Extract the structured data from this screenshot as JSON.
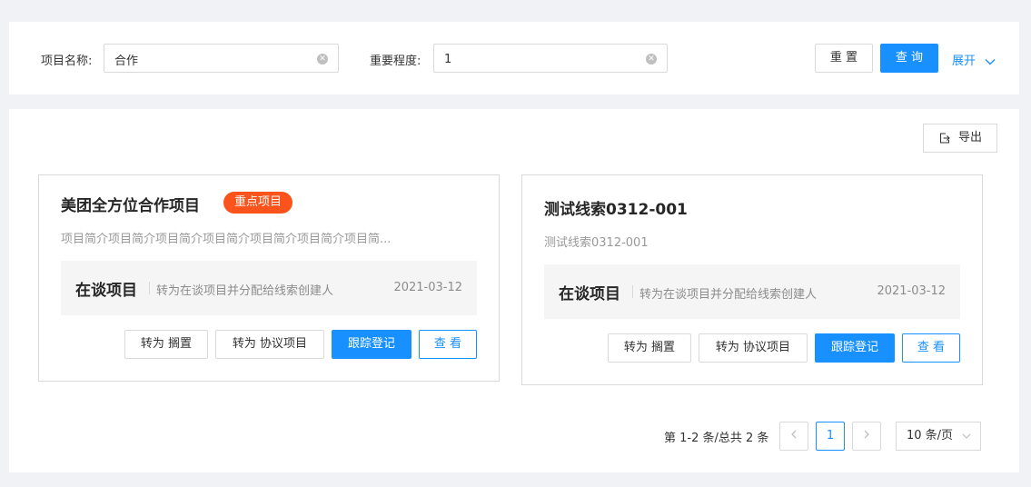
{
  "filters": {
    "project_name_label": "项目名称:",
    "project_name_value": "合作",
    "importance_label": "重要程度:",
    "importance_value": "1",
    "reset_label": "重 置",
    "search_label": "查 询",
    "expand_label": "展开"
  },
  "toolbar": {
    "export_label": "导出"
  },
  "cards": [
    {
      "title": "美团全方位合作项目",
      "tag": "重点项目",
      "description": "项目简介项目简介项目简介项目简介项目简介项目简介项目简...",
      "status": "在谈项目",
      "status_note": "转为在谈项目并分配给线索创建人",
      "date": "2021-03-12",
      "actions": [
        "转为 搁置",
        "转为 协议项目",
        "跟踪登记",
        "查 看"
      ]
    },
    {
      "title": "测试线索0312-001",
      "description": "测试线索0312-001",
      "status": "在谈项目",
      "status_note": "转为在谈项目并分配给线索创建人",
      "date": "2021-03-12",
      "actions": [
        "转为 搁置",
        "转为 协议项目",
        "跟踪登记",
        "查 看"
      ]
    }
  ],
  "pagination": {
    "summary": "第 1-2 条/总共 2 条",
    "current_page": "1",
    "page_size": "10 条/页"
  },
  "colors": {
    "primary": "#1890ff",
    "tag": "#fa541c"
  },
  "icons": [
    "clear-icon",
    "chevron-down-icon",
    "export-icon",
    "chevron-left-icon",
    "chevron-right-icon"
  ]
}
